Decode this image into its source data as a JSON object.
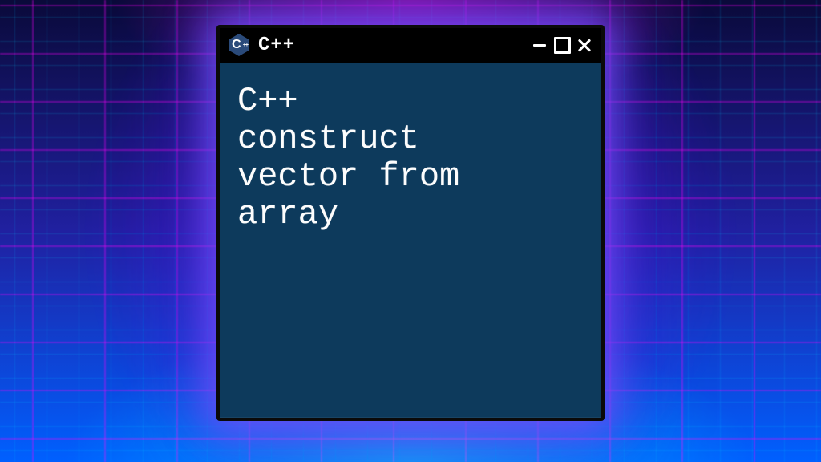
{
  "window": {
    "title": "C++",
    "logo_letter": "C",
    "logo_plus": "++"
  },
  "body": {
    "text": "C++\nconstruct\nvector from\narray"
  },
  "colors": {
    "window_bg": "#0d3a5c",
    "titlebar_bg": "#000000",
    "text": "#ffffff",
    "glow": "#7850ff"
  }
}
